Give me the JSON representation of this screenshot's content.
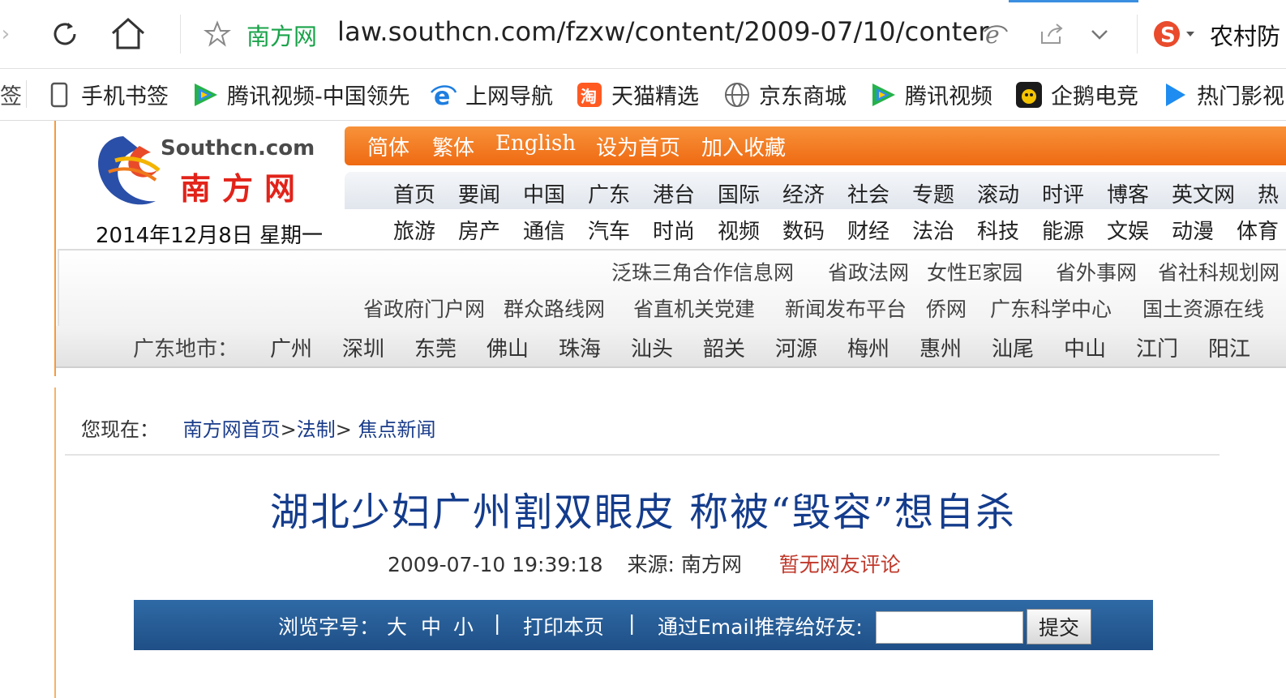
{
  "browser": {
    "site_name": "南方网",
    "url": "law.southcn.com/fzxw/content/2009-07/10/conter",
    "right_tab_label": "农村防",
    "bookmarks": [
      {
        "label": "手机书签",
        "icon": "phone-icon"
      },
      {
        "label": "腾讯视频-中国领先",
        "icon": "tencent-video-icon"
      },
      {
        "label": "上网导航",
        "icon": "ie-icon"
      },
      {
        "label": "天猫精选",
        "icon": "tmall-icon"
      },
      {
        "label": "京东商城",
        "icon": "globe-icon"
      },
      {
        "label": "腾讯视频",
        "icon": "tencent-video-icon"
      },
      {
        "label": "企鹅电竞",
        "icon": "penguin-icon"
      },
      {
        "label": "热门影视",
        "icon": "play-icon"
      }
    ],
    "bookmark_edge_fragment": "签"
  },
  "header": {
    "logo_en": "Southcn.com",
    "logo_cn": "南方网",
    "date": "2014年12月8日 星期一",
    "top_links": [
      "简体",
      "繁体",
      "English",
      "设为首页",
      "加入收藏"
    ],
    "nav_row1": [
      "首页",
      "要闻",
      "中国",
      "广东",
      "港台",
      "国际",
      "经济",
      "社会",
      "专题",
      "滚动",
      "时评",
      "博客",
      "英文网",
      "热"
    ],
    "nav_row2": [
      "旅游",
      "房产",
      "通信",
      "汽车",
      "时尚",
      "视频",
      "数码",
      "财经",
      "法治",
      "科技",
      "能源",
      "文娱",
      "动漫",
      "体育"
    ],
    "partner_row1": [
      "泛珠三角合作信息网",
      "省政法网",
      "女性E家园",
      "省外事网",
      "省社科规划网"
    ],
    "partner_row2": [
      "省政府门户网",
      "群众路线网",
      "省直机关党建",
      "新闻发布平台",
      "侨网",
      "广东科学中心",
      "国土资源在线"
    ],
    "city_label": "广东地市：",
    "cities": [
      "广州",
      "深圳",
      "东莞",
      "佛山",
      "珠海",
      "汕头",
      "韶关",
      "河源",
      "梅州",
      "惠州",
      "汕尾",
      "中山",
      "江门",
      "阳江"
    ]
  },
  "article": {
    "breadcrumb_prefix": "您现在：",
    "breadcrumb": [
      "南方网首页",
      "法制",
      "焦点新闻"
    ],
    "title": "湖北少妇广州割双眼皮  称被“毁容”想自杀",
    "datetime": "2009-07-10 19:39:18",
    "source": "来源: 南方网",
    "comments": "暂无网友评论"
  },
  "tools": {
    "font_label": "浏览字号：",
    "sizes": [
      "大",
      "中",
      "小"
    ],
    "separator": "|",
    "print": "打印本页",
    "email_label": "通过Email推荐给好友:",
    "email_value": "",
    "submit": "提交"
  },
  "colors": {
    "orange": "#ef6a12",
    "title_blue": "#143c8c",
    "link_blue": "#1a3c8a",
    "toolbar_blue": "#2f6aa6",
    "comment_red": "#c0392b",
    "site_green": "#1aa34a"
  }
}
